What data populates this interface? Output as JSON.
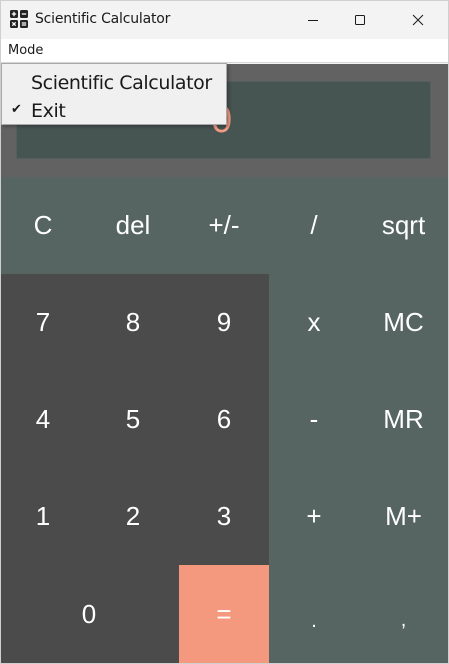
{
  "window": {
    "title": "Scientific Calculator",
    "icon": "calculator-icon",
    "controls": [
      "minimize-icon",
      "maximize-icon",
      "close-icon"
    ]
  },
  "menu_bar": {
    "mode_label": "Mode"
  },
  "mode_menu": {
    "items": [
      {
        "label": "Scientific Calculator",
        "checked": false
      },
      {
        "label": "Exit",
        "checked": true
      }
    ],
    "check_glyph": "✔"
  },
  "display": {
    "value": "0"
  },
  "keys": {
    "row1": [
      "C",
      "del",
      "+/-",
      "/",
      "sqrt"
    ],
    "row2": [
      "7",
      "8",
      "9",
      "x",
      "MC"
    ],
    "row3": [
      "4",
      "5",
      "6",
      "-",
      "MR"
    ],
    "row4": [
      "1",
      "2",
      "3",
      "+",
      "M+"
    ],
    "row5": [
      "0",
      "=",
      ".",
      ","
    ]
  },
  "colors": {
    "display_bg": "#465452",
    "display_text": "#f39a82",
    "function_keys_bg": "#566462",
    "number_keys_bg": "#4b4b4b",
    "equals_bg": "#f4987e"
  }
}
